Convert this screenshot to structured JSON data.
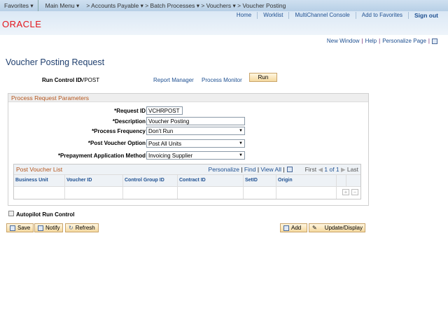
{
  "nav": {
    "favorites": "Favorites",
    "main_menu": "Main Menu",
    "crumbs": [
      "Accounts Payable",
      "Batch Processes",
      "Vouchers"
    ],
    "current": "Voucher Posting"
  },
  "header": {
    "links": [
      "Home",
      "Worklist",
      "MultiChannel Console",
      "Add to Favorites"
    ],
    "sign_out": "Sign out",
    "logo": "ORACLE"
  },
  "page_links": {
    "new_window": "New Window",
    "help": "Help",
    "personalize": "Personalize Page"
  },
  "page_title": "Voucher Posting Request",
  "run_control": {
    "label": "Run Control ID",
    "value": "VPOST",
    "report_manager": "Report Manager",
    "process_monitor": "Process Monitor",
    "run": "Run"
  },
  "params": {
    "title": "Process Request Parameters",
    "request_id": {
      "label": "*Request ID",
      "value": "VCHRPOST"
    },
    "description": {
      "label": "*Description",
      "value": "Voucher Posting"
    },
    "frequency": {
      "label": "*Process Frequency",
      "value": "Don't Run"
    },
    "post_option": {
      "label": "*Post Voucher Option",
      "value": "Post All Units"
    },
    "prepay": {
      "label": "*Prepayment Application Method",
      "value": "Invoicing Supplier"
    }
  },
  "grid": {
    "title": "Post Voucher List",
    "personalize": "Personalize",
    "find": "Find",
    "view_all": "View All",
    "first": "First",
    "count": "1 of 1",
    "last": "Last",
    "columns": [
      "Business Unit",
      "Voucher ID",
      "Control Group ID",
      "Contract ID",
      "SetID",
      "Origin"
    ]
  },
  "autopilot": {
    "label": "Autopilot Run Control",
    "checked": false
  },
  "buttons": {
    "save": "Save",
    "notify": "Notify",
    "refresh": "Refresh",
    "add": "Add",
    "update": "Update/Display"
  },
  "colors": {
    "accent": "#1d4f91",
    "section": "#b5561d",
    "logo": "#e3161c"
  }
}
